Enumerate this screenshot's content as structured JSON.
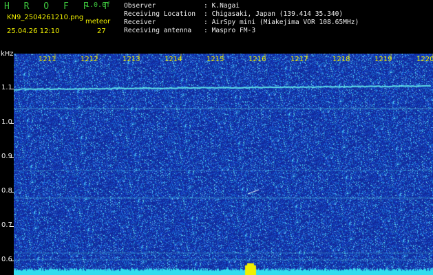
{
  "header": {
    "app_title": "H R O F F T",
    "version": "1.0.0f",
    "filename": "KN9_2504261210.png",
    "meteor_label": "meteor",
    "datetime": "25.04.26 12:10",
    "meteor_count": "27"
  },
  "station_info": [
    {
      "label": "Observer",
      "value": "K.Nagai"
    },
    {
      "label": "Receiving Location",
      "value": "Chigasaki, Japan (139.414 35.340)"
    },
    {
      "label": "Receiver",
      "value": "AirSpy mini (Miakejima VOR 108.65MHz)"
    },
    {
      "label": "Receiving antenna",
      "value": "Maspro FM-3"
    }
  ],
  "spectrogram": {
    "y_axis_unit": "kHz",
    "y_ticks": [
      "1.1",
      "1.0",
      "0.9",
      "0.8",
      "0.7",
      "0.6"
    ],
    "x_ticks": [
      "1211",
      "1212",
      "1213",
      "1214",
      "1215",
      "1216",
      "1217",
      "1218",
      "1219",
      "1220"
    ],
    "colors": {
      "background": "#12289a",
      "noise_bright": "#2fa8e8",
      "carrier": "#5ee0e8",
      "baseline": "#33ddee",
      "burst": "#f0f000"
    }
  }
}
